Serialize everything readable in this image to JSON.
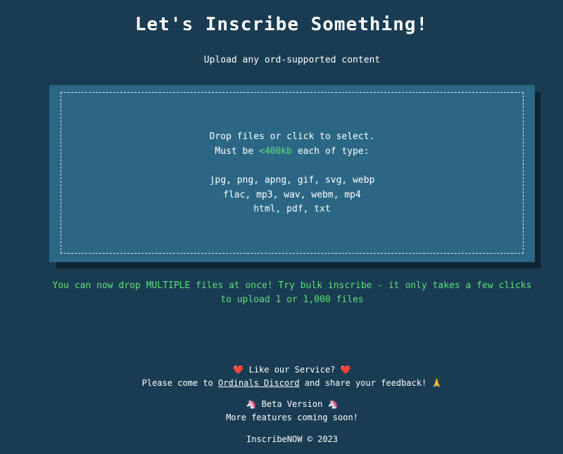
{
  "header": {
    "title": "Let's Inscribe Something!",
    "subtitle": "Upload any ord-supported content"
  },
  "dropzone": {
    "line1": "Drop files or click to select.",
    "size_prefix": "Must be ",
    "size_limit": "<400kb",
    "size_suffix": " each of type:",
    "types": [
      "jpg, png, apng, gif, svg, webp",
      "flac, mp3, wav, webm, mp4",
      "html, pdf, txt"
    ]
  },
  "bulk_note": "You can now drop MULTIPLE files at once! Try bulk inscribe - it only takes a few clicks to upload 1 or 1,000 files",
  "footer": {
    "like_text": "❤️ Like our Service? ❤️",
    "come_prefix": "Please come to ",
    "discord_link": "Ordinals Discord",
    "come_suffix": " and share your feedback! 🙏",
    "beta": "🦄 Beta Version 🦄",
    "more": "More features coming soon!",
    "copyright": "InscribeNOW © 2023"
  },
  "colors": {
    "background": "#193c52",
    "dropzone": "#2b6784",
    "accent_green": "#5ee07a"
  }
}
